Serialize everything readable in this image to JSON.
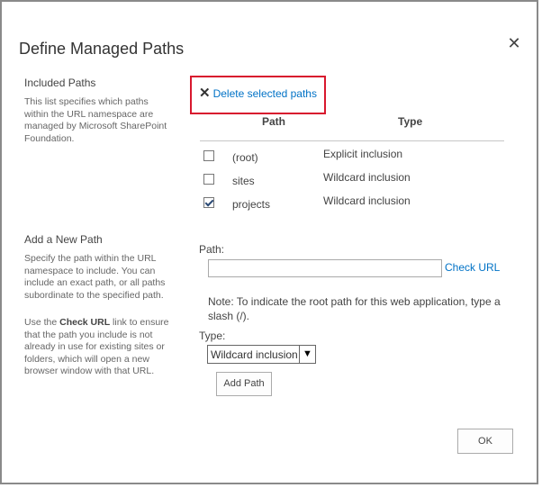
{
  "dialog": {
    "title": "Define Managed Paths"
  },
  "included": {
    "heading": "Included Paths",
    "description": "This list specifies which paths within the URL namespace are managed by Microsoft SharePoint Foundation.",
    "delete_label": "Delete selected paths",
    "columns": {
      "path": "Path",
      "type": "Type"
    },
    "rows": [
      {
        "path": "(root)",
        "type": "Explicit inclusion",
        "checked": false
      },
      {
        "path": "sites",
        "type": "Wildcard inclusion",
        "checked": false
      },
      {
        "path": "projects",
        "type": "Wildcard inclusion",
        "checked": true
      }
    ]
  },
  "add_new": {
    "heading": "Add a New Path",
    "description1": "Specify the path within the URL namespace to include. You can include an exact path, or all paths subordinate to the specified path.",
    "description2_pre": "Use the ",
    "description2_bold": "Check URL",
    "description2_post": " link to ensure that the path you include is not already in use for existing sites or folders, which will open a new browser window with that URL.",
    "path_label": "Path:",
    "path_value": "",
    "check_url_label": "Check URL",
    "note": "Note: To indicate the root path for this web application, type a slash (/).",
    "type_label": "Type:",
    "type_selected": "Wildcard inclusion",
    "add_button": "Add Path"
  },
  "footer": {
    "ok_button": "OK"
  }
}
